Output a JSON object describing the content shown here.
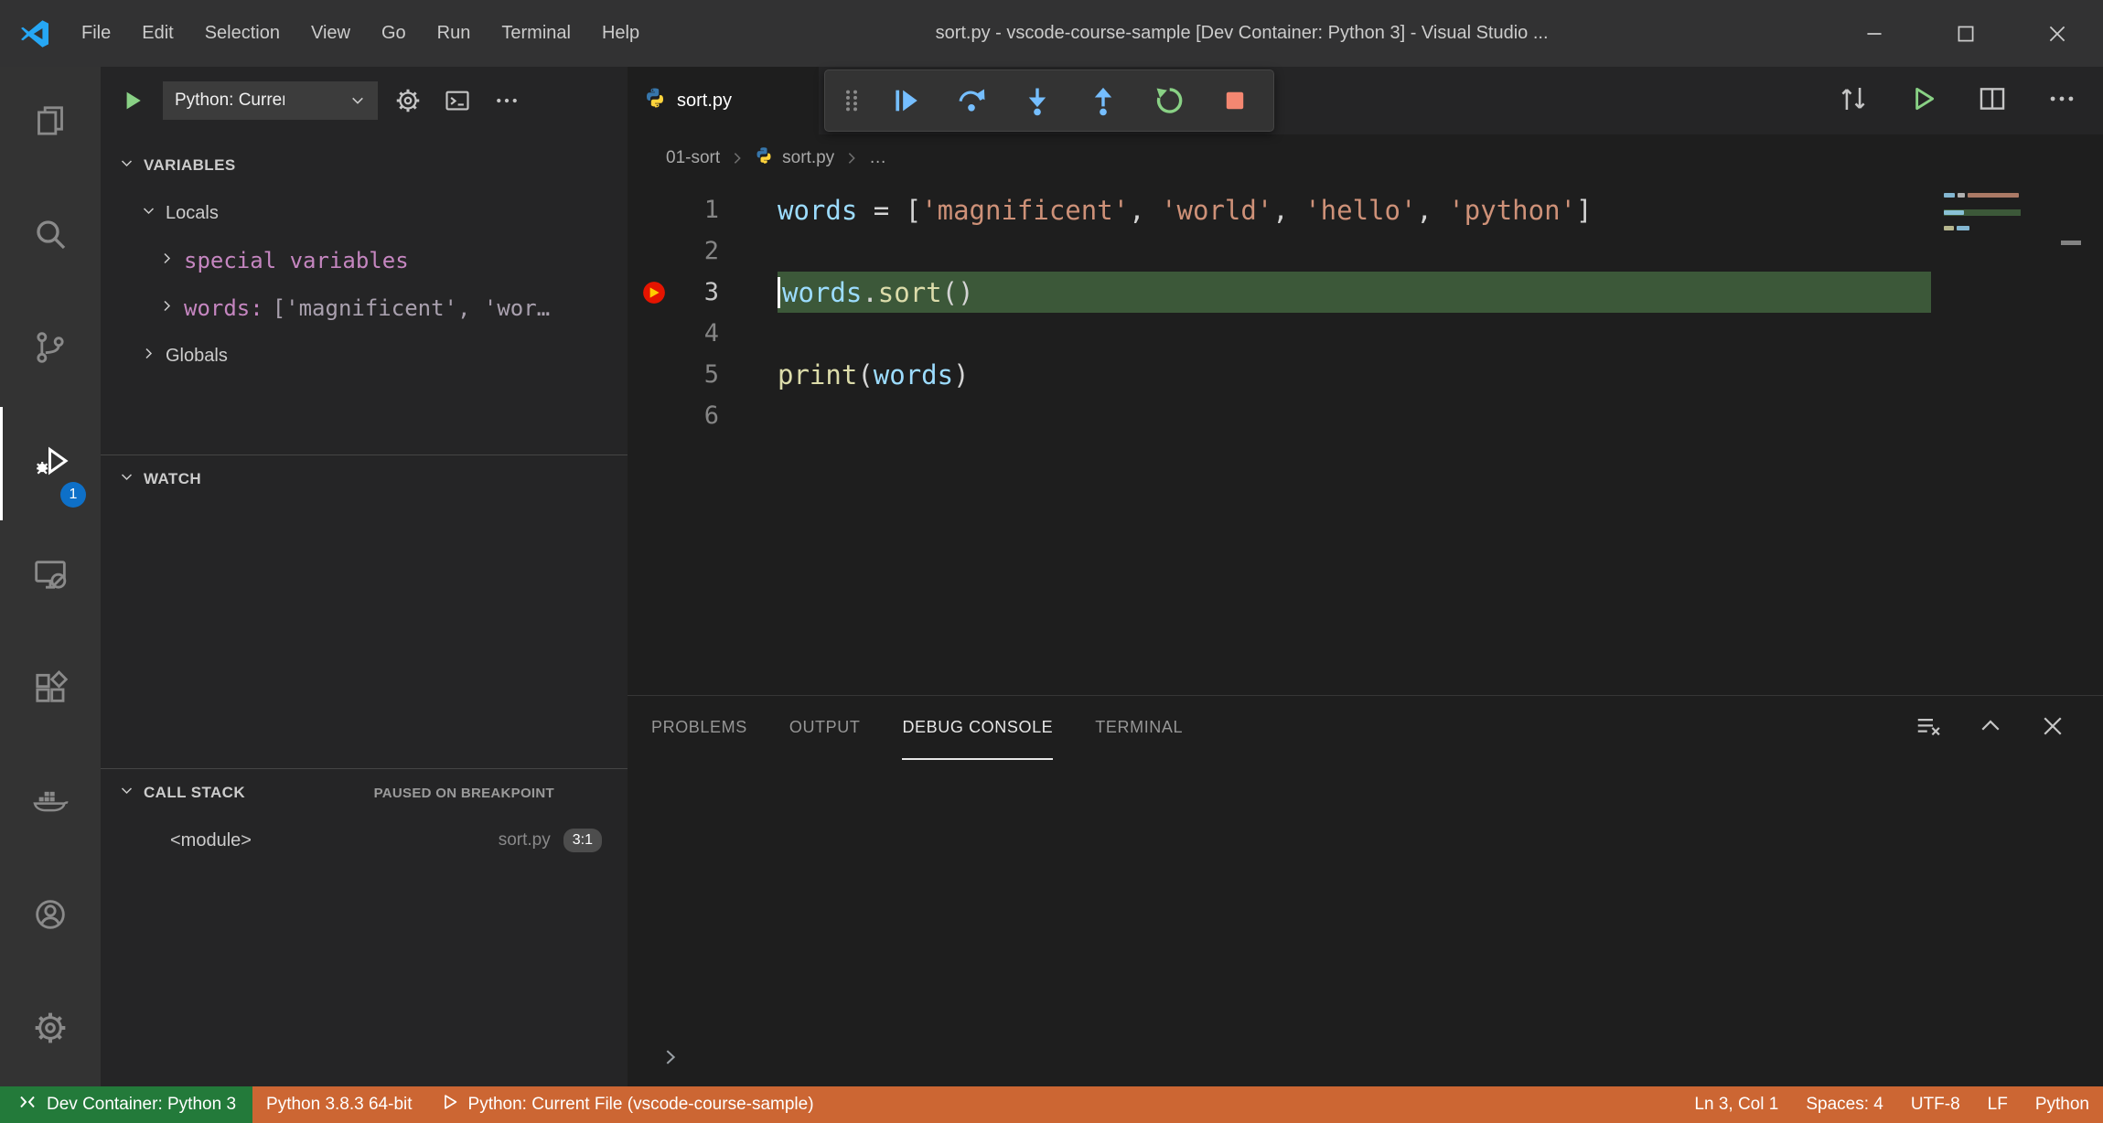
{
  "window": {
    "title": "sort.py - vscode-course-sample [Dev Container: Python 3] - Visual Studio ...",
    "menus": [
      "File",
      "Edit",
      "Selection",
      "View",
      "Go",
      "Run",
      "Terminal",
      "Help"
    ]
  },
  "activity_bar": {
    "badge": "1",
    "items": [
      "explorer",
      "search",
      "source-control",
      "run-and-debug",
      "remote-explorer",
      "extensions",
      "docker",
      "accounts",
      "settings"
    ]
  },
  "sidebar": {
    "run_config": "Python: Current File",
    "variables": {
      "header": "VARIABLES",
      "locals_label": "Locals",
      "special_label": "special variables",
      "words_name": "words:",
      "words_value": "['magnificent', 'wor…",
      "globals_label": "Globals"
    },
    "watch": {
      "header": "WATCH"
    },
    "call_stack": {
      "header": "CALL STACK",
      "status": "PAUSED ON BREAKPOINT",
      "frame": {
        "name": "<module>",
        "file": "sort.py",
        "location": "3:1"
      }
    }
  },
  "editor": {
    "tab": {
      "label": "sort.py"
    },
    "breadcrumbs": {
      "folder": "01-sort",
      "file": "sort.py",
      "more": "…"
    },
    "lines": [
      {
        "number": "1",
        "tokens": [
          {
            "text": "words",
            "type": "variable"
          },
          {
            "text": " = [",
            "type": "punctuation"
          },
          {
            "text": "'magnificent'",
            "type": "string"
          },
          {
            "text": ", ",
            "type": "punctuation"
          },
          {
            "text": "'world'",
            "type": "string"
          },
          {
            "text": ", ",
            "type": "punctuation"
          },
          {
            "text": "'hello'",
            "type": "string"
          },
          {
            "text": ", ",
            "type": "punctuation"
          },
          {
            "text": "'python'",
            "type": "string"
          },
          {
            "text": "]",
            "type": "punctuation"
          }
        ]
      },
      {
        "number": "2",
        "tokens": []
      },
      {
        "number": "3",
        "current": true,
        "breakpoint": true,
        "tokens": [
          {
            "text": "words",
            "type": "variable"
          },
          {
            "text": ".",
            "type": "punctuation"
          },
          {
            "text": "sort",
            "type": "function"
          },
          {
            "text": "()",
            "type": "punctuation"
          }
        ]
      },
      {
        "number": "4",
        "tokens": []
      },
      {
        "number": "5",
        "tokens": [
          {
            "text": "print",
            "type": "function"
          },
          {
            "text": "(",
            "type": "punctuation"
          },
          {
            "text": "words",
            "type": "variable"
          },
          {
            "text": ")",
            "type": "punctuation"
          }
        ]
      },
      {
        "number": "6",
        "tokens": []
      }
    ]
  },
  "panel": {
    "tabs": [
      "PROBLEMS",
      "OUTPUT",
      "DEBUG CONSOLE",
      "TERMINAL"
    ],
    "active_tab": "DEBUG CONSOLE"
  },
  "status_bar": {
    "remote": "Dev Container: Python 3",
    "python_version": "Python 3.8.3 64-bit",
    "run_config": "Python: Current File (vscode-course-sample)",
    "line_col": "Ln 3, Col 1",
    "indentation": "Spaces: 4",
    "encoding": "UTF-8",
    "eol": "LF",
    "language": "Python"
  },
  "icons": {
    "activity_bar": [
      "explorer-icon",
      "search-icon",
      "source-control-icon",
      "run-and-debug-icon",
      "remote-explorer-icon",
      "extensions-icon",
      "docker-icon",
      "accounts-icon",
      "settings-gear-icon"
    ],
    "debug_toolbar": [
      "gripper-icon",
      "continue-icon",
      "step-over-icon",
      "step-into-icon",
      "step-out-icon",
      "restart-icon",
      "stop-icon"
    ],
    "panel": [
      "clear-console-icon",
      "maximize-panel-icon",
      "close-panel-icon",
      "console-prompt-icon"
    ],
    "statusbar": [
      "remote-indicator-icon",
      "run-play-icon"
    ]
  },
  "colors": {
    "status_bar_debugging": "#cc6633",
    "remote_indicator_green": "#237a3a",
    "activity_badge_blue": "#0e70c8",
    "current_line_highlight": "#3c5839",
    "breakpoint_red": "#e51400",
    "debug_step_blue": "#75beff",
    "restart_green": "#89d185",
    "stop_red": "#f48771",
    "string_color": "#ce9178",
    "variable_color": "#9cdcfe",
    "function_color": "#dcdcaa",
    "debug_var_purple": "#c586c0"
  }
}
